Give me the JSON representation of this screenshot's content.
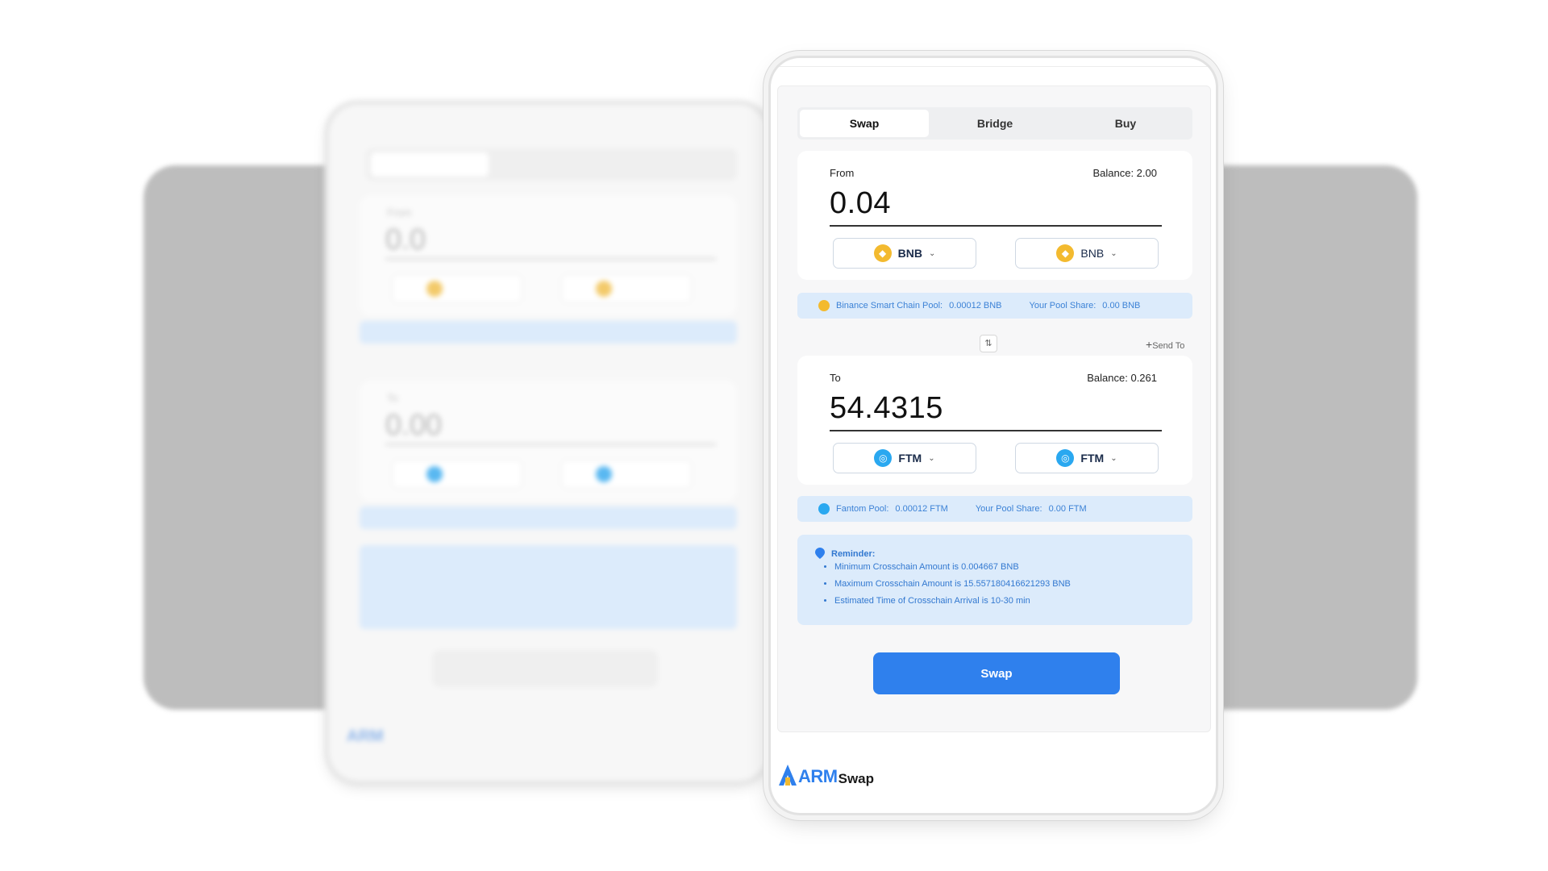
{
  "tabs": [
    {
      "label": "Swap",
      "active": true
    },
    {
      "label": "Bridge",
      "active": false
    },
    {
      "label": "Buy",
      "active": false
    }
  ],
  "from": {
    "label": "From",
    "balance": "Balance: 2.00",
    "amount": "0.04",
    "token_left": "BNB",
    "token_right": "BNB",
    "coin_icon": "bnb-coin-icon"
  },
  "from_pool": {
    "chain_label": "Binance Smart Chain Pool:",
    "chain_value": "0.00012 BNB",
    "share_label": "Your Pool Share:",
    "share_value": "0.00 BNB"
  },
  "send_to": "Send To",
  "to": {
    "label": "To",
    "balance": "Balance: 0.261",
    "amount": "54.4315",
    "token_left": "FTM",
    "token_right": "FTM",
    "coin_icon": "ftm-coin-icon"
  },
  "to_pool": {
    "chain_label": "Fantom Pool:",
    "chain_value": "0.00012 FTM",
    "share_label": "Your Pool Share:",
    "share_value": "0.00 FTM"
  },
  "reminder": {
    "title": "Reminder:",
    "items": [
      "Minimum Crosschain Amount is 0.004667 BNB",
      "Maximum Crosschain Amount is 15.557180416621293 BNB",
      "Estimated Time of Crosschain Arrival is 10-30 min"
    ]
  },
  "swap_button": "Swap",
  "logo": {
    "arm": "ARM",
    "swap": "Swap"
  },
  "colors": {
    "accent": "#2f80ed",
    "bnb": "#f3ba2f",
    "ftm": "#2aa8f0",
    "info_bg": "#dcebfb"
  }
}
